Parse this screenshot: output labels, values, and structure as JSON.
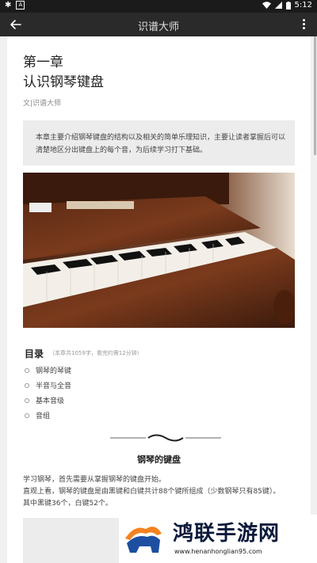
{
  "status_bar": {
    "left_icons": [
      "bug-icon",
      "a-icon"
    ],
    "time": "5:12",
    "right_icons": [
      "wifi-icon",
      "signal-icon",
      "battery-icon"
    ]
  },
  "app_bar": {
    "title": "识谱大师",
    "back_icon": "arrow-left-icon",
    "more_icon": "more-vertical-icon"
  },
  "article": {
    "chapter": "第一章",
    "title": "认识钢琴键盘",
    "author": "文|识谱大师",
    "intro": "本章主要介绍钢琴键盘的结构以及相关的简单乐理知识，主要让读者掌握后可以清楚地区分出键盘上的每个音，为后续学习打下基础。",
    "toc_title": "目录",
    "toc_meta": "（本章共1059字，看完约需12分钟）",
    "toc_items": [
      "钢琴的琴键",
      "半音与全音",
      "基本音级",
      "音组"
    ],
    "section_title": "钢琴的键盘",
    "paragraphs": [
      "学习钢琴，首先需要从掌握钢琴的键盘开始。",
      "直观上看，钢琴的键盘是由黑键和白键共计88个键所组成（少数钢琴只有85键）。",
      "其中黑键36个，白键52个。"
    ]
  },
  "watermark": {
    "name": "鸿联手游网",
    "url": "www.henanhonglian95.com"
  },
  "colors": {
    "status_bar": "#1b1b1b",
    "app_bar": "#2a2a2a",
    "page_bg": "#f0f0f0",
    "card_bg": "#ffffff",
    "intro_bg": "#ececec"
  }
}
